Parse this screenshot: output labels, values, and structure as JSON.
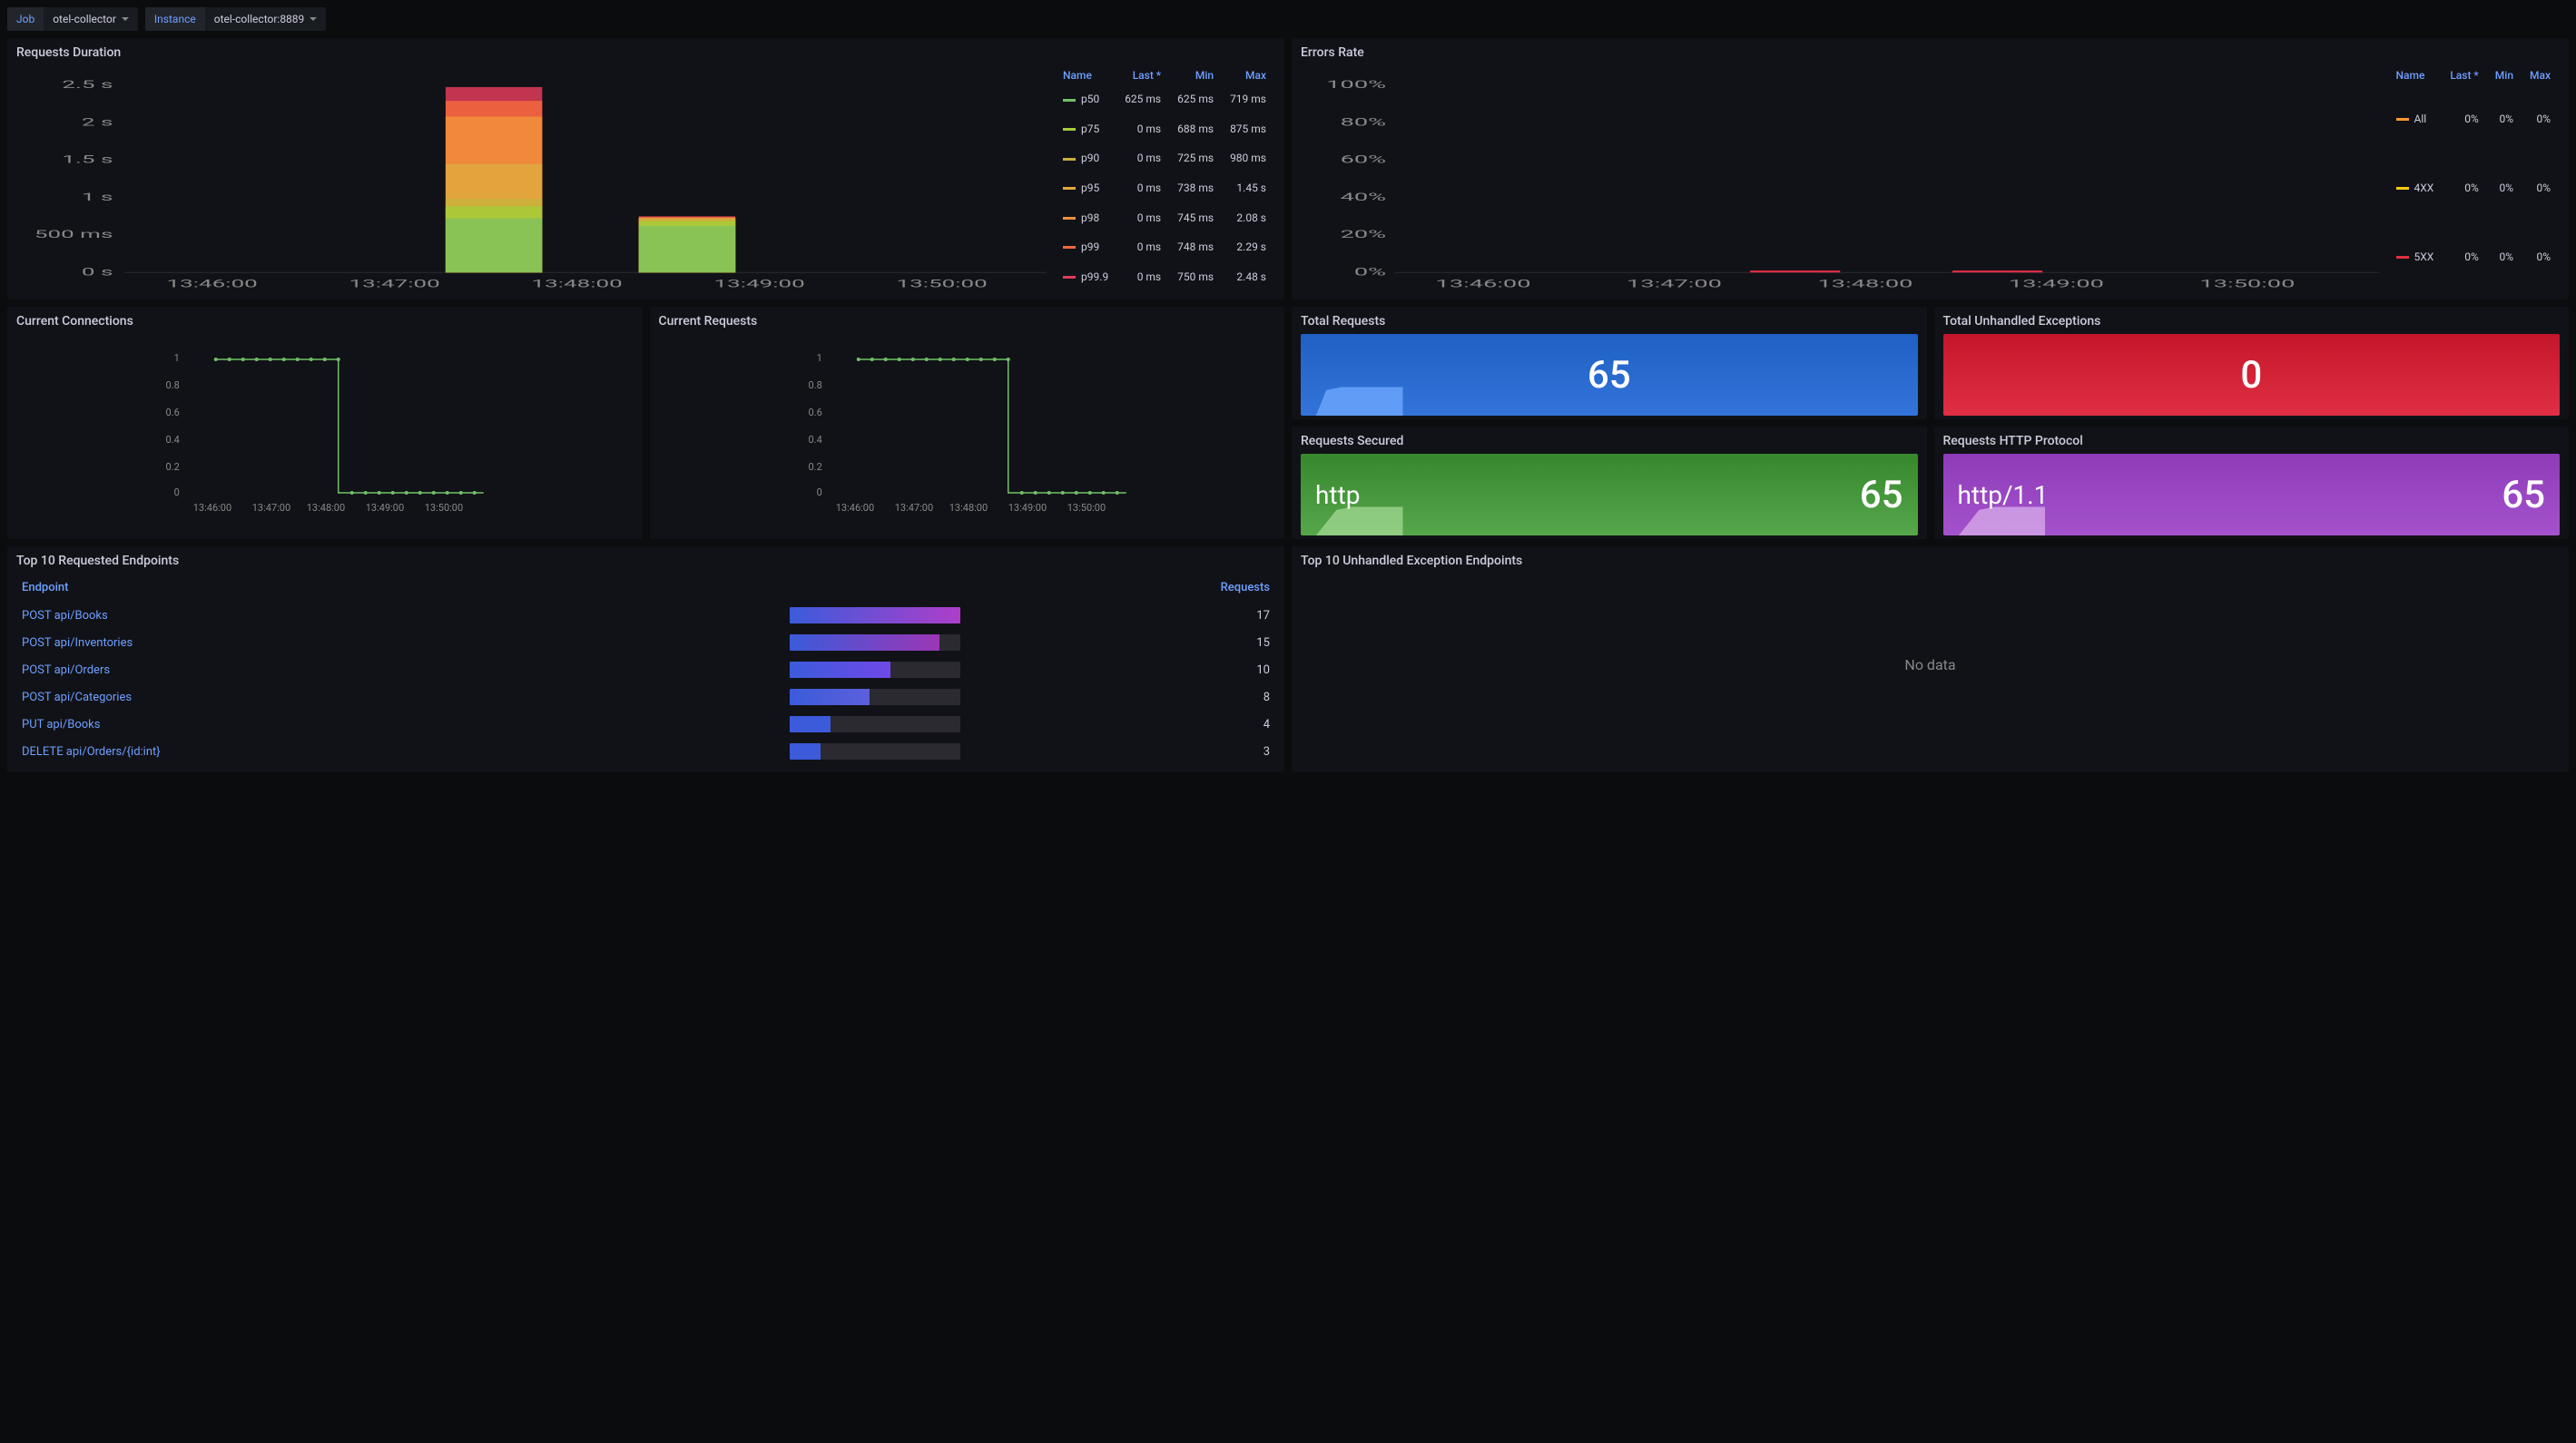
{
  "toolbar": {
    "job_label": "Job",
    "job_value": "otel-collector",
    "instance_label": "Instance",
    "instance_value": "otel-collector:8889"
  },
  "panels": {
    "requests_duration": {
      "title": "Requests Duration"
    },
    "errors_rate": {
      "title": "Errors Rate"
    },
    "current_connections": {
      "title": "Current Connections"
    },
    "current_requests": {
      "title": "Current Requests"
    },
    "total_requests": {
      "title": "Total Requests",
      "value": "65"
    },
    "total_unhandled": {
      "title": "Total Unhandled Exceptions",
      "value": "0"
    },
    "requests_secured": {
      "title": "Requests Secured",
      "label": "http",
      "value": "65"
    },
    "requests_protocol": {
      "title": "Requests HTTP Protocol",
      "label": "http/1.1",
      "value": "65"
    },
    "top_endpoints": {
      "title": "Top 10 Requested Endpoints"
    },
    "top_exceptions": {
      "title": "Top 10 Unhandled Exception Endpoints",
      "nodata": "No data"
    }
  },
  "legend_headers": [
    "Name",
    "Last *",
    "Min",
    "Max"
  ],
  "duration_legend": [
    {
      "color": "#73bf69",
      "name": "p50",
      "last": "625 ms",
      "min": "625 ms",
      "max": "719 ms"
    },
    {
      "color": "#a6cc3a",
      "name": "p75",
      "last": "0 ms",
      "min": "688 ms",
      "max": "875 ms"
    },
    {
      "color": "#c9b13a",
      "name": "p90",
      "last": "0 ms",
      "min": "725 ms",
      "max": "980 ms"
    },
    {
      "color": "#e0a93e",
      "name": "p95",
      "last": "0 ms",
      "min": "738 ms",
      "max": "1.45 s"
    },
    {
      "color": "#f2903c",
      "name": "p98",
      "last": "0 ms",
      "min": "745 ms",
      "max": "2.08 s"
    },
    {
      "color": "#f2693c",
      "name": "p99",
      "last": "0 ms",
      "min": "748 ms",
      "max": "2.29 s"
    },
    {
      "color": "#e03c5a",
      "name": "p99.9",
      "last": "0 ms",
      "min": "750 ms",
      "max": "2.48 s"
    }
  ],
  "errors_legend": [
    {
      "color": "#ff9830",
      "name": "All",
      "last": "0%",
      "min": "0%",
      "max": "0%"
    },
    {
      "color": "#f2cc0c",
      "name": "4XX",
      "last": "0%",
      "min": "0%",
      "max": "0%"
    },
    {
      "color": "#e02f44",
      "name": "5XX",
      "last": "0%",
      "min": "0%",
      "max": "0%"
    }
  ],
  "endpoints_headers": {
    "endpoint": "Endpoint",
    "requests": "Requests"
  },
  "endpoints": [
    {
      "name": "POST api/Books",
      "requests": 17,
      "pct": 100,
      "color": "linear-gradient(90deg,#3b5bdb,#ae3ec9)"
    },
    {
      "name": "POST api/Inventories",
      "requests": 15,
      "pct": 88,
      "color": "linear-gradient(90deg,#3b5bdb,#9c36b5)"
    },
    {
      "name": "POST api/Orders",
      "requests": 10,
      "pct": 59,
      "color": "linear-gradient(90deg,#3b5bdb,#7048e8)"
    },
    {
      "name": "POST api/Categories",
      "requests": 8,
      "pct": 47,
      "color": "linear-gradient(90deg,#3b5bdb,#5c5fdb)"
    },
    {
      "name": "PUT api/Books",
      "requests": 4,
      "pct": 24,
      "color": "#3b5bdb"
    },
    {
      "name": "DELETE api/Orders/{id:int}",
      "requests": 3,
      "pct": 18,
      "color": "#3b5bdb"
    }
  ],
  "chart_data": [
    {
      "panel": "requests_duration",
      "type": "bar",
      "y_ticks": [
        "0 s",
        "500 ms",
        "1 s",
        "1.5 s",
        "2 s",
        "2.5 s"
      ],
      "x_ticks": [
        "13:46:00",
        "13:47:00",
        "13:48:00",
        "13:49:00",
        "13:50:00"
      ],
      "series_at_1348": {
        "p50": 0.719,
        "p75": 0.875,
        "p90": 0.98,
        "p95": 1.45,
        "p98": 2.08,
        "p99": 2.29,
        "p99.9": 2.48
      },
      "series_at_1349": {
        "p50": 0.625,
        "p75": 0.688,
        "p90": 0.725,
        "p95": 0.738,
        "p98": 0.745,
        "p99": 0.748,
        "p99.9": 0.75
      }
    },
    {
      "panel": "errors_rate",
      "type": "line",
      "y_ticks": [
        "0%",
        "20%",
        "40%",
        "60%",
        "80%",
        "100%"
      ],
      "x_ticks": [
        "13:46:00",
        "13:47:00",
        "13:48:00",
        "13:49:00",
        "13:50:00"
      ],
      "series": [
        {
          "name": "All",
          "values": [
            0,
            0,
            0,
            0,
            0
          ]
        },
        {
          "name": "4XX",
          "values": [
            0,
            0,
            0,
            0,
            0
          ]
        },
        {
          "name": "5XX",
          "values": [
            0,
            0,
            0,
            0,
            0
          ]
        }
      ]
    },
    {
      "panel": "current_connections",
      "type": "line",
      "y_ticks": [
        "0",
        "0.2",
        "0.4",
        "0.6",
        "0.8",
        "1"
      ],
      "x_ticks": [
        "13:46:00",
        "13:47:00",
        "13:48:00",
        "13:49:00",
        "13:50:00"
      ],
      "values": [
        1,
        1,
        1,
        1,
        1,
        1,
        1,
        1,
        1,
        1,
        0,
        0,
        0,
        0,
        0,
        0,
        0,
        0,
        0,
        0,
        0,
        0,
        0,
        0
      ]
    },
    {
      "panel": "current_requests",
      "type": "line",
      "y_ticks": [
        "0",
        "0.2",
        "0.4",
        "0.6",
        "0.8",
        "1"
      ],
      "x_ticks": [
        "13:46:00",
        "13:47:00",
        "13:48:00",
        "13:49:00",
        "13:50:00"
      ],
      "values": [
        1,
        1,
        1,
        1,
        1,
        1,
        1,
        1,
        1,
        1,
        1,
        1,
        1,
        0,
        0,
        0,
        0,
        0,
        0,
        0,
        0,
        0,
        0,
        0
      ]
    }
  ]
}
